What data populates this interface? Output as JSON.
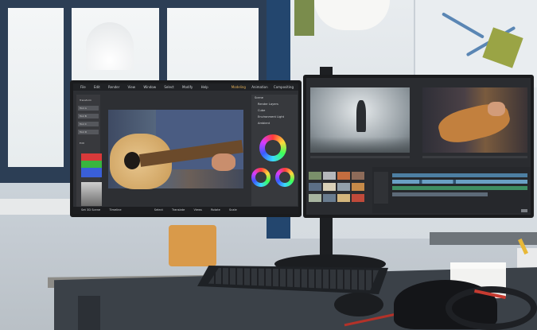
{
  "left_monitor": {
    "menu": [
      "File",
      "Edit",
      "Render",
      "View",
      "Window",
      "Select",
      "Modify",
      "Help"
    ],
    "tabs": [
      "Modeling",
      "Animation",
      "Compositing"
    ],
    "sidebar": {
      "header": "Transform",
      "items": [
        "Tool A",
        "Tool B",
        "Tool C",
        "Tool D"
      ],
      "section": "Edit"
    },
    "scene_panel": {
      "title": "Scene",
      "rows": [
        "Render Layers",
        "Cube",
        "Environment Light",
        "Ambient"
      ]
    },
    "status": [
      "Set 3D Scene",
      "Timeline",
      "Select",
      "Translate",
      "Views",
      "Rotate",
      "Scale"
    ]
  },
  "colors": {
    "wheel_rainbow": "conic",
    "accent_red": "#c63b31",
    "wall_blue": "#23466e",
    "chair_orange": "#d99a4a"
  }
}
